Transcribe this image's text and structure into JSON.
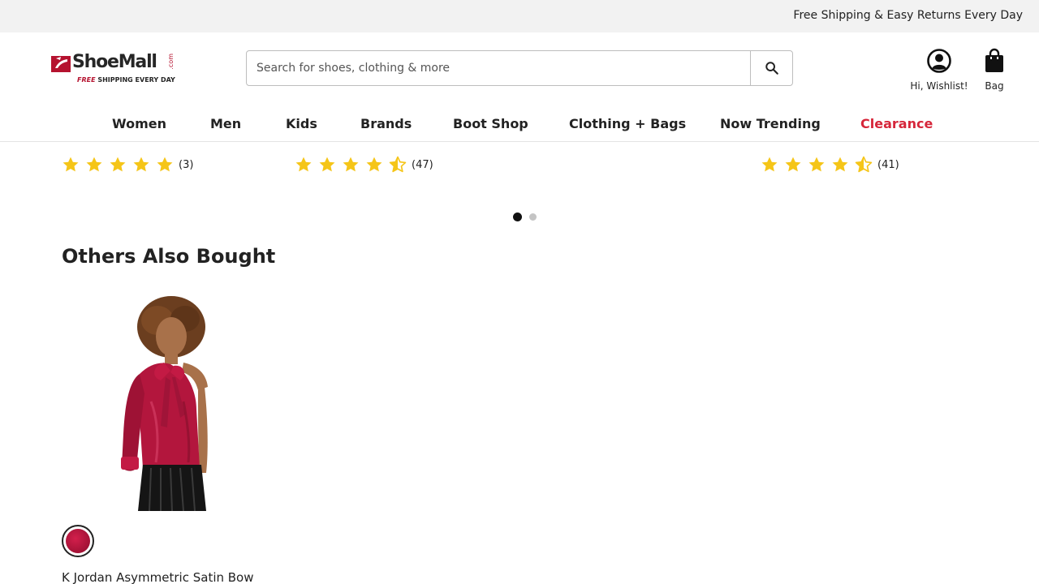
{
  "promo": {
    "text": "Free Shipping & Easy Returns Every Day"
  },
  "brand": {
    "name": "ShoeMall",
    "suffix": ".com",
    "tagline_free": "FREE",
    "tagline_rest": " SHIPPING EVERY DAY",
    "accent_color": "#b5122f"
  },
  "search": {
    "placeholder": "Search for shoes, clothing & more",
    "value": "",
    "icon": "search-icon"
  },
  "account": {
    "label": "Hi, Wishlist!",
    "icon": "user-circle-icon"
  },
  "bag": {
    "label": "Bag",
    "icon": "shopping-bag-icon"
  },
  "nav": {
    "items": [
      {
        "label": "Women"
      },
      {
        "label": "Men"
      },
      {
        "label": "Kids"
      },
      {
        "label": "Brands"
      },
      {
        "label": "Boot Shop"
      },
      {
        "label": "Clothing + Bags"
      },
      {
        "label": "Now Trending"
      },
      {
        "label": "Clearance",
        "color": "#d6263a"
      }
    ]
  },
  "carousel_ratings": [
    {
      "stars": 5,
      "count": "(3)"
    },
    {
      "stars": 4.5,
      "count": "(47)"
    },
    {
      "stars": 4.5,
      "count": "(41)"
    }
  ],
  "carousel": {
    "pages": 2,
    "current_page": 1
  },
  "others_also_bought": {
    "title": "Others Also Bought",
    "products": [
      {
        "name": "K Jordan Asymmetric Satin Bow",
        "swatch_color": "#b3163d",
        "image_icon": "product-photo-satin-blouse"
      }
    ]
  },
  "colors": {
    "star": "#f5c518",
    "text": "#222222",
    "promo_bg": "#f2f2f2"
  }
}
